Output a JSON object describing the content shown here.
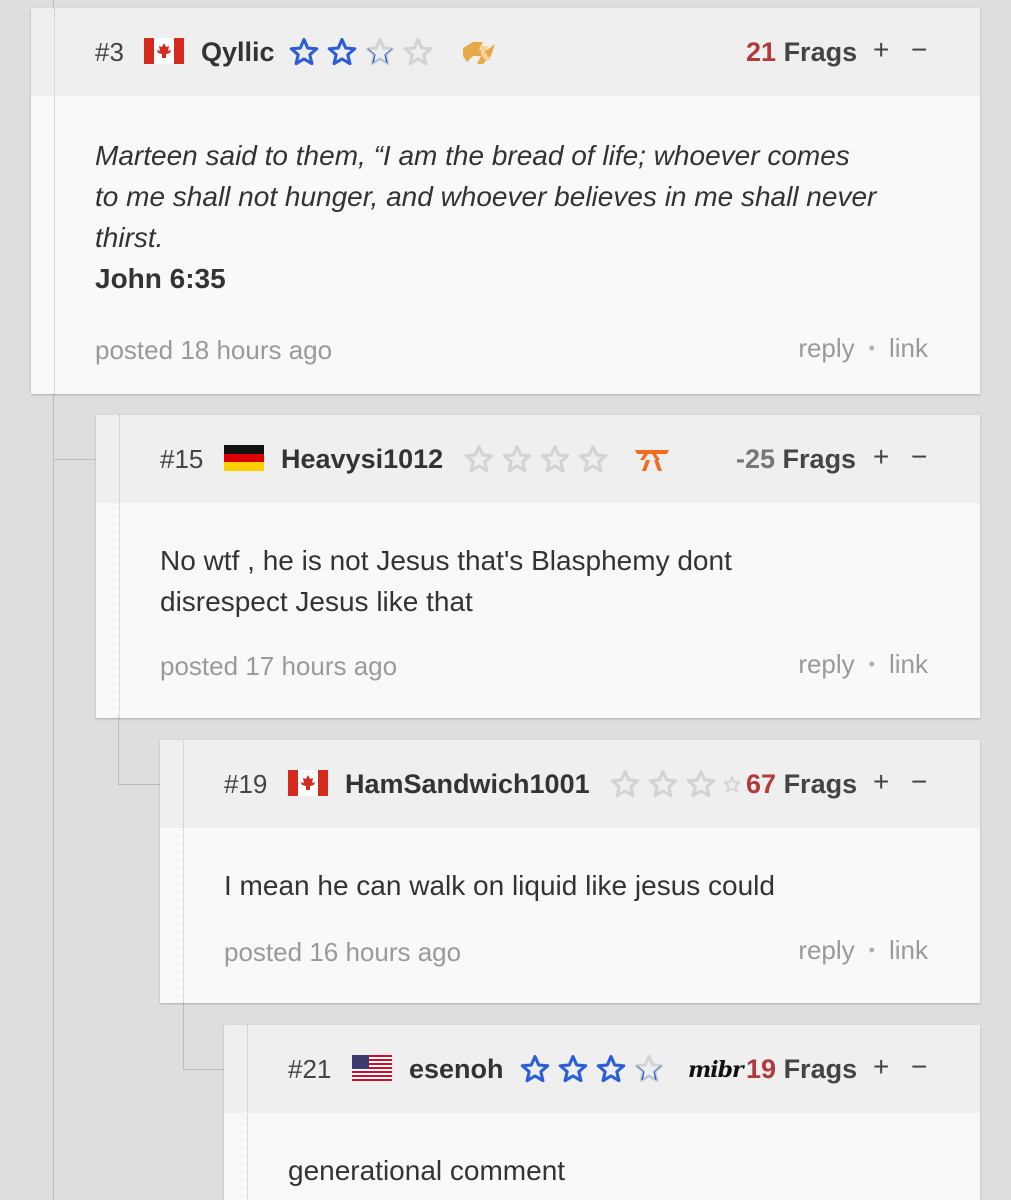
{
  "colors": {
    "page_bg": "#dedede",
    "post_header_bg": "#efefef",
    "post_body_bg": "#f9f9f9",
    "frags_positive": "#b23a3a",
    "frags_negative": "#777777",
    "star_filled": "#2b5fd9",
    "star_empty": "#d3d3d3"
  },
  "posts": [
    {
      "number": "#3",
      "country": "canada-flag",
      "username": "Qyllic",
      "stars_filled": 2.5,
      "team_icon": "rr-team-icon",
      "frags_value": "21",
      "frags_label": "Frags",
      "vote_up": "+",
      "vote_down": "−",
      "text_quote_line1": "Marteen said to them, “I am the bread of life; whoever comes",
      "text_quote_line2": "to me shall not hunger, and whoever believes in me shall never",
      "text_quote_line3": "thirst.",
      "text_ref": "John 6:35",
      "posted_prefix": "posted",
      "posted_ago": "18 hours ago",
      "reply": "reply",
      "link": "link"
    },
    {
      "number": "#15",
      "country": "germany-flag",
      "username": "Heavysi1012",
      "stars_filled": 0,
      "team_icon": "fnatic-team-icon",
      "frags_value": "-25",
      "frags_label": "Frags",
      "vote_up": "+",
      "vote_down": "−",
      "text_line1": "No wtf , he is not Jesus that's Blasphemy dont",
      "text_line2": "disrespect Jesus like that",
      "posted_prefix": "posted",
      "posted_ago": "17 hours ago",
      "reply": "reply",
      "link": "link"
    },
    {
      "number": "#19",
      "country": "canada-flag",
      "username": "HamSandwich1001",
      "stars_filled": 0,
      "frags_value": "67",
      "frags_label": "Frags",
      "vote_up": "+",
      "vote_down": "−",
      "text_line1": "I mean he can walk on liquid like jesus could",
      "posted_prefix": "posted",
      "posted_ago": "16 hours ago",
      "reply": "reply",
      "link": "link"
    },
    {
      "number": "#21",
      "country": "usa-flag",
      "username": "esenoh",
      "stars_filled": 3.5,
      "team_icon": "mibr-team-icon",
      "team_text": "mibr",
      "frags_value": "19",
      "frags_label": "Frags",
      "vote_up": "+",
      "vote_down": "−",
      "text_line1": "generational comment"
    }
  ]
}
